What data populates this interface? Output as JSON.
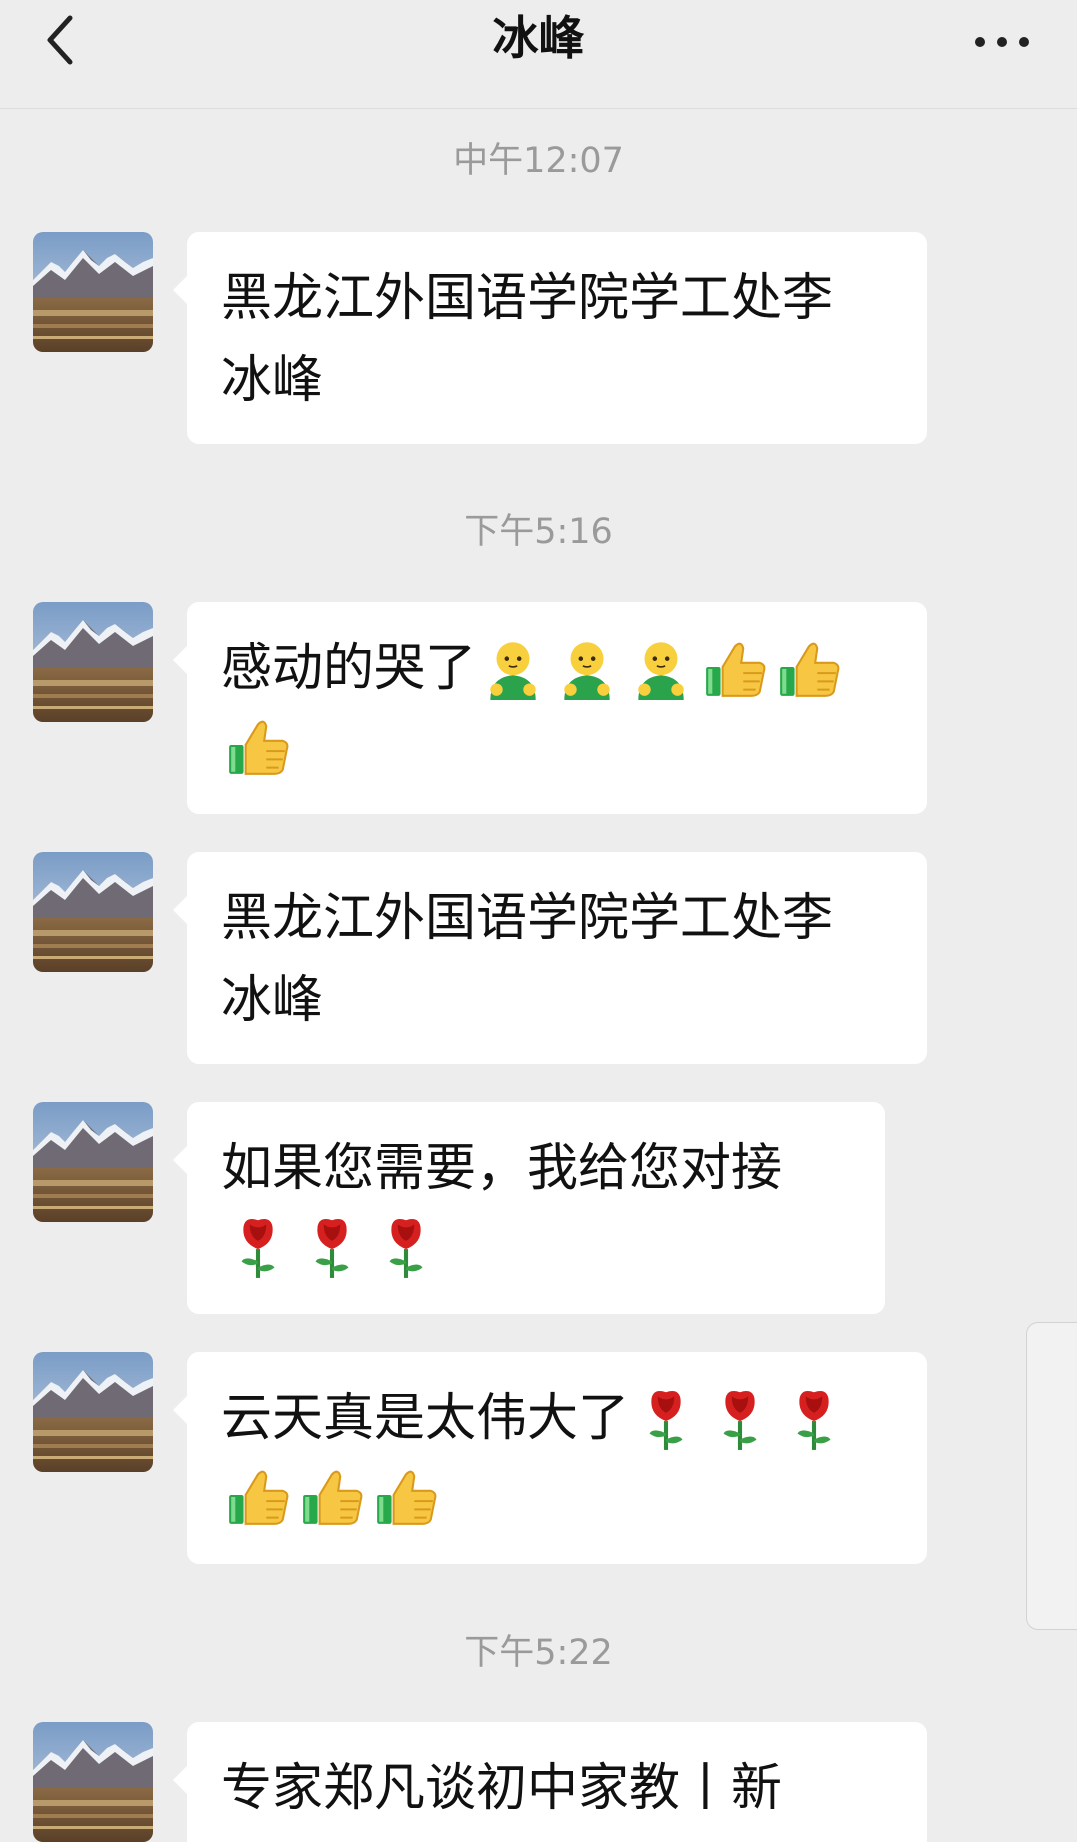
{
  "header": {
    "title": "冰峰"
  },
  "messages": {
    "ts1": "中午12:07",
    "m1_line1": "黑龙江外国语学院学工处李",
    "m1_line2": "冰峰",
    "ts2": "下午5:16",
    "m2_line1": "感动的哭了",
    "m3_line1": "黑龙江外国语学院学工处李",
    "m3_line2": "冰峰",
    "m4_line1": "如果您需要，我给您对接",
    "m5_line1": "云天真是太伟大了",
    "ts3": "下午5:22",
    "m6_line1": "专家郑凡谈初中家教丨新"
  },
  "icons": {
    "back": "chevron-left-icon",
    "more": "more-dots-icon",
    "emoji_shy": "shy-face-emoji",
    "emoji_thumb": "thumbs-up-emoji",
    "emoji_rose": "rose-emoji"
  },
  "colors": {
    "background": "#ededed",
    "bubble": "#ffffff",
    "timestamp": "#9a9a9a"
  }
}
